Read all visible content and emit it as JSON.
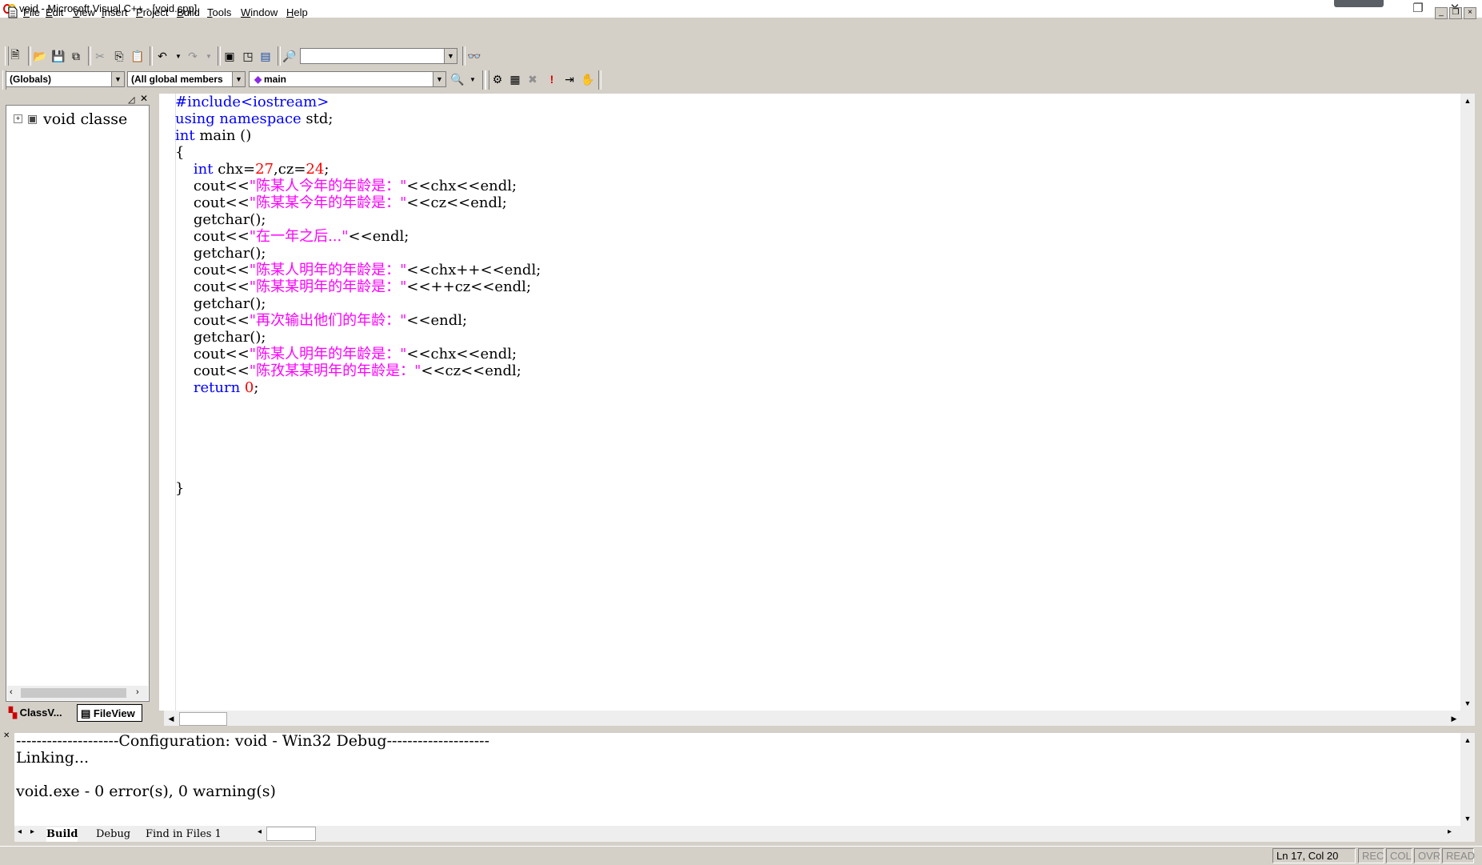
{
  "window": {
    "title": "void - Microsoft Visual C++ - [void.cpp]",
    "controls": {
      "minimize": "–",
      "restore": "❐",
      "close": "✕"
    }
  },
  "menu": {
    "items": [
      {
        "key": "F",
        "rest": "ile"
      },
      {
        "key": "E",
        "rest": "dit"
      },
      {
        "key": "V",
        "rest": "iew"
      },
      {
        "key": "I",
        "rest": "nsert"
      },
      {
        "key": "P",
        "rest": "roject"
      },
      {
        "key": "B",
        "rest": "uild"
      },
      {
        "key": "T",
        "rest": "ools"
      },
      {
        "key": "W",
        "rest": "indow"
      },
      {
        "key": "H",
        "rest": "elp"
      }
    ],
    "mdi": {
      "minimize": "_",
      "restore": "❐",
      "close": "×"
    }
  },
  "toolbar": {
    "find_value": ""
  },
  "wizardbar": {
    "class_combo": "(Globals)",
    "filter_combo": "(All global members",
    "member_combo": "main"
  },
  "workspace": {
    "tree_root": "void classe",
    "tabs": {
      "classview": "ClassV...",
      "fileview": "FileView"
    }
  },
  "editor": {
    "lines": [
      [
        {
          "t": "#include<iostream>",
          "c": "kw"
        }
      ],
      [
        {
          "t": "using namespace",
          "c": "kw"
        },
        {
          "t": " std;",
          "c": ""
        }
      ],
      [
        {
          "t": "int",
          "c": "kw"
        },
        {
          "t": " main ()",
          "c": ""
        }
      ],
      [
        {
          "t": "{",
          "c": ""
        }
      ],
      [
        {
          "t": "    ",
          "c": ""
        },
        {
          "t": "int",
          "c": "kw"
        },
        {
          "t": " chx=",
          "c": ""
        },
        {
          "t": "27",
          "c": "num"
        },
        {
          "t": ",cz=",
          "c": ""
        },
        {
          "t": "24",
          "c": "num"
        },
        {
          "t": ";",
          "c": ""
        }
      ],
      [
        {
          "t": "    cout<<",
          "c": ""
        },
        {
          "t": "\"陈某人今年的年龄是：\"",
          "c": "str"
        },
        {
          "t": "<<chx<<endl;",
          "c": ""
        }
      ],
      [
        {
          "t": "    cout<<",
          "c": ""
        },
        {
          "t": "\"陈某某今年的年龄是：\"",
          "c": "str"
        },
        {
          "t": "<<cz<<endl;",
          "c": ""
        }
      ],
      [
        {
          "t": "    getchar();",
          "c": ""
        }
      ],
      [
        {
          "t": "    cout<<",
          "c": ""
        },
        {
          "t": "\"在一年之后...\"",
          "c": "str"
        },
        {
          "t": "<<endl;",
          "c": ""
        }
      ],
      [
        {
          "t": "    getchar();",
          "c": ""
        }
      ],
      [
        {
          "t": "    cout<<",
          "c": ""
        },
        {
          "t": "\"陈某人明年的年龄是：\"",
          "c": "str"
        },
        {
          "t": "<<chx++<<endl;",
          "c": ""
        }
      ],
      [
        {
          "t": "    cout<<",
          "c": ""
        },
        {
          "t": "\"陈某某明年的年龄是：\"",
          "c": "str"
        },
        {
          "t": "<<++cz<<endl;",
          "c": ""
        }
      ],
      [
        {
          "t": "    getchar();",
          "c": ""
        }
      ],
      [
        {
          "t": "    cout<<",
          "c": ""
        },
        {
          "t": "\"再次输出他们的年龄：\"",
          "c": "str"
        },
        {
          "t": "<<endl;",
          "c": ""
        }
      ],
      [
        {
          "t": "    getchar();",
          "c": ""
        }
      ],
      [
        {
          "t": "    cout<<",
          "c": ""
        },
        {
          "t": "\"陈某人明年的年龄是：\"",
          "c": "str"
        },
        {
          "t": "<<chx<<endl;",
          "c": ""
        }
      ],
      [
        {
          "t": "    cout<<",
          "c": ""
        },
        {
          "t": "\"陈孜某某明年的年龄是：\"",
          "c": "str"
        },
        {
          "t": "<<cz<<endl;",
          "c": ""
        }
      ],
      [
        {
          "t": "    ",
          "c": ""
        },
        {
          "t": "return",
          "c": "kw"
        },
        {
          "t": " ",
          "c": ""
        },
        {
          "t": "0",
          "c": "num"
        },
        {
          "t": ";",
          "c": ""
        }
      ],
      [
        {
          "t": "",
          "c": ""
        }
      ],
      [
        {
          "t": "",
          "c": ""
        }
      ],
      [
        {
          "t": "",
          "c": ""
        }
      ],
      [
        {
          "t": "",
          "c": ""
        }
      ],
      [
        {
          "t": "",
          "c": ""
        }
      ],
      [
        {
          "t": "}",
          "c": ""
        }
      ]
    ]
  },
  "output": {
    "lines": [
      "--------------------Configuration: void - Win32 Debug--------------------",
      "Linking...",
      "",
      "void.exe - 0 error(s), 0 warning(s)"
    ],
    "tabs": {
      "build": "Build",
      "debug": "Debug",
      "find": "Find in Files 1"
    }
  },
  "status": {
    "position": "Ln 17, Col 20",
    "rec": "REC",
    "col": "COL",
    "ovr": "OVR",
    "read": "READ"
  },
  "colors": {
    "keyword": "#0000ff",
    "string": "#ff00ff",
    "number": "#ff0000",
    "chrome": "#d4d0c8"
  }
}
